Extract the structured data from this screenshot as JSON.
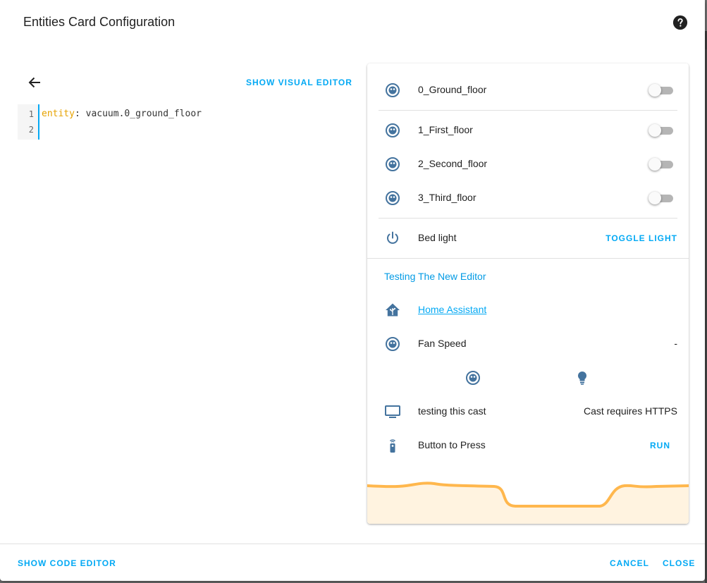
{
  "dialog": {
    "title": "Entities Card Configuration",
    "help_icon": "help-circle-icon"
  },
  "editor": {
    "back_icon": "arrow-left-icon",
    "show_visual_editor": "SHOW VISUAL EDITOR",
    "lines": [
      {
        "number": "1",
        "key": "entity",
        "sep": ": ",
        "value": "vacuum.0_ground_floor"
      },
      {
        "number": "2",
        "key": "",
        "sep": "",
        "value": ""
      }
    ]
  },
  "preview": {
    "rows": [
      {
        "icon": "robot-vacuum-icon",
        "label": "0_Ground_floor",
        "state": "off"
      },
      {
        "icon": "robot-vacuum-icon",
        "label": "1_First_floor",
        "state": "off"
      },
      {
        "icon": "robot-vacuum-icon",
        "label": "2_Second_floor",
        "state": "off"
      },
      {
        "icon": "robot-vacuum-icon",
        "label": "3_Third_floor",
        "state": "off"
      }
    ],
    "bed_light": {
      "icon": "power-icon",
      "label": "Bed light",
      "action": "TOGGLE LIGHT"
    },
    "section_title": "Testing The New Editor",
    "weblink": {
      "icon": "home-assistant-icon",
      "label": "Home Assistant"
    },
    "fan_speed": {
      "icon": "robot-vacuum-icon",
      "label": "Fan Speed",
      "value": "-"
    },
    "buttons_row": [
      {
        "icon": "robot-vacuum-icon"
      },
      {
        "icon": "lightbulb-icon"
      }
    ],
    "cast": {
      "icon": "television-icon",
      "label": "testing this cast",
      "value": "Cast requires HTTPS"
    },
    "button_row": {
      "icon": "remote-icon",
      "label": "Button to Press",
      "action": "RUN"
    },
    "colors": {
      "accent": "#03a9f4",
      "icon": "#44739e",
      "graph_line": "#ffb74d",
      "graph_fill": "#fff3e0"
    }
  },
  "footer": {
    "show_code_editor": "SHOW CODE EDITOR",
    "cancel": "CANCEL",
    "close": "CLOSE"
  }
}
